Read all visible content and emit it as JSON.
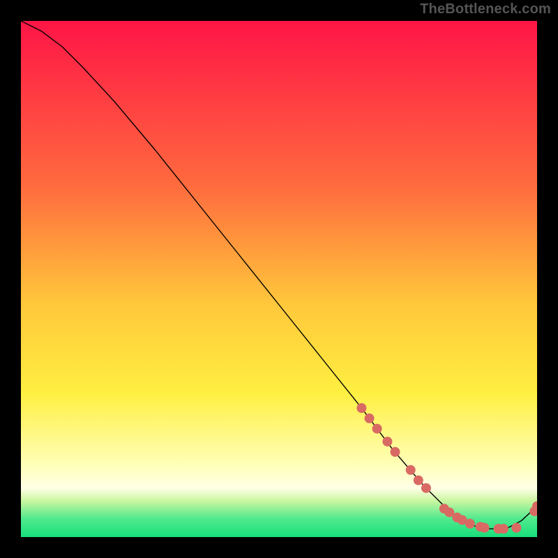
{
  "attribution": "TheBottleneck.com",
  "colors": {
    "gradient_top": "#ff1546",
    "gradient_upper_mid": "#ff8d3c",
    "gradient_yellow": "#ffec3f",
    "gradient_pale": "#ffffc2",
    "gradient_green": "#1be47f",
    "curve": "#000000",
    "marker": "#d96a63",
    "background": "#000000",
    "attribution": "#555555"
  },
  "chart_data": {
    "type": "line",
    "title": "",
    "xlabel": "",
    "ylabel": "",
    "xlim": [
      0,
      100
    ],
    "ylim": [
      0,
      100
    ],
    "curve": {
      "x": [
        0,
        4,
        8,
        12,
        18,
        26,
        34,
        42,
        50,
        58,
        66,
        72,
        78,
        82,
        85,
        88,
        91,
        94,
        97,
        100
      ],
      "y": [
        100,
        98,
        95,
        91,
        84.5,
        75,
        65,
        55,
        45,
        35,
        25,
        17,
        10,
        6,
        3.5,
        2.1,
        1.6,
        1.6,
        3.2,
        6
      ]
    },
    "markers": {
      "x": [
        66,
        67.5,
        69,
        71,
        72.5,
        75.5,
        77,
        78.5,
        82,
        83,
        84.5,
        85.5,
        87,
        89,
        89.8,
        92.5,
        93.5,
        96,
        99.5,
        100
      ],
      "y": [
        25,
        23,
        21,
        18.5,
        16.5,
        13,
        11,
        9.5,
        5.5,
        4.8,
        3.8,
        3.3,
        2.6,
        2.0,
        1.8,
        1.6,
        1.6,
        1.8,
        5.0,
        6
      ]
    },
    "gradient_stops": [
      {
        "offset": 0.0,
        "color": "#ff1546"
      },
      {
        "offset": 0.32,
        "color": "#ff6b3e"
      },
      {
        "offset": 0.55,
        "color": "#ffc83b"
      },
      {
        "offset": 0.72,
        "color": "#ffef40"
      },
      {
        "offset": 0.86,
        "color": "#ffffb8"
      },
      {
        "offset": 0.905,
        "color": "#ffffe6"
      },
      {
        "offset": 0.93,
        "color": "#c9f6a0"
      },
      {
        "offset": 0.965,
        "color": "#4fe98d"
      },
      {
        "offset": 1.0,
        "color": "#17df7b"
      }
    ]
  }
}
